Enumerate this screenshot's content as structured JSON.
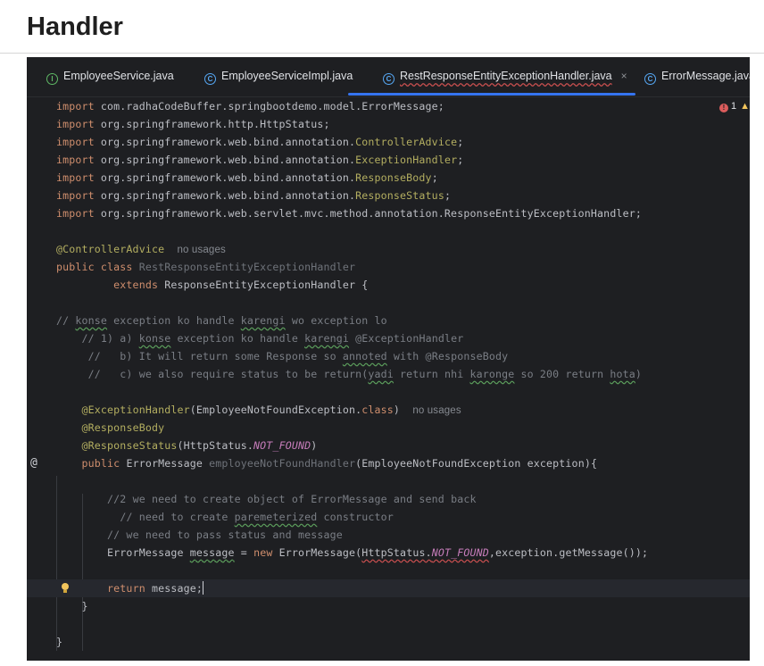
{
  "page": {
    "heading": "Handler"
  },
  "tabs": [
    {
      "label": "EmployeeService.java",
      "icon": "interface-icon",
      "active": false
    },
    {
      "label": "EmployeeServiceImpl.java",
      "icon": "class-icon",
      "active": false
    },
    {
      "label": "RestResponseEntityExceptionHandler.java",
      "icon": "class-icon",
      "active": true,
      "close": "×"
    },
    {
      "label": "ErrorMessage.java",
      "icon": "class-icon",
      "active": false
    }
  ],
  "problems": {
    "errors": "1"
  },
  "gutter": {
    "implements_marker": "@"
  },
  "code": {
    "import1_kw": "import",
    "import1_rest": " com.radhaCodeBuffer.springbootdemo.model.ErrorMessage;",
    "import2_kw": "import",
    "import2_rest": " org.springframework.http.HttpStatus;",
    "import3_kw": "import",
    "import3_pkg": " org.springframework.web.bind.annotation.",
    "import3_cls": "ControllerAdvice",
    "import3_end": ";",
    "import4_kw": "import",
    "import4_pkg": " org.springframework.web.bind.annotation.",
    "import4_cls": "ExceptionHandler",
    "import4_end": ";",
    "import5_kw": "import",
    "import5_pkg": " org.springframework.web.bind.annotation.",
    "import5_cls": "ResponseBody",
    "import5_end": ";",
    "import6_kw": "import",
    "import6_pkg": " org.springframework.web.bind.annotation.",
    "import6_cls": "ResponseStatus",
    "import6_end": ";",
    "import7_kw": "import",
    "import7_rest": " org.springframework.web.servlet.mvc.method.annotation.ResponseEntityExceptionHandler;",
    "ann_controller": "@ControllerAdvice",
    "ann_controller_hint": "no usages",
    "class_kw": "public class",
    "class_name": "RestResponseEntityExceptionHandler",
    "extends_kw": "extends",
    "extends_rest": " ResponseEntityExceptionHandler {",
    "c1_a": "// ",
    "c1_w1": "konse",
    "c1_b": " exception ko handle ",
    "c1_w2": "karengi",
    "c1_c": " wo exception lo",
    "c2_a": "// 1) a) ",
    "c2_w1": "konse",
    "c2_b": " exception ko handle ",
    "c2_w2": "karengi",
    "c2_c": " @ExceptionHandler",
    "c3_a": "//   b) It will return some Response so ",
    "c3_w1": "annoted",
    "c3_b": " with @ResponseBody",
    "c4_a": "//   c) we also require status to be return(",
    "c4_w1": "yadi",
    "c4_b": " return nhi ",
    "c4_w2": "karonge",
    "c4_c": " so 200 return ",
    "c4_w3": "hota",
    "c4_d": ")",
    "eh_ann": "@ExceptionHandler",
    "eh_paren": "(EmployeeNotFoundException.",
    "eh_class": "class",
    "eh_close": ")",
    "eh_hint": "no usages",
    "rb_ann": "@ResponseBody",
    "rs_ann": "@ResponseStatus",
    "rs_a": "(HttpStatus.",
    "rs_const": "NOT_FOUND",
    "rs_b": ")",
    "m_kw": "public",
    "m_type": " ErrorMessage ",
    "m_name": "employeeNotFoundHandler",
    "m_params": "(EmployeeNotFoundException exception){",
    "c5": "//2 we need to create object of ErrorMessage and send back",
    "c6_a": "// need to create ",
    "c6_w1": "paremeterized",
    "c6_b": " constructor",
    "c7": "// we need to pass status and message",
    "decl_a": "ErrorMessage ",
    "decl_var": "message",
    "decl_b": " = ",
    "decl_new": "new",
    "decl_c": " ErrorMessage(",
    "decl_err": "HttpStatus.",
    "decl_const": "NOT_FOUND",
    "decl_d": ",exception.getMessage());",
    "ret_kw": "return",
    "ret_rest": " message;",
    "close_method": "}",
    "close_class": "}"
  }
}
